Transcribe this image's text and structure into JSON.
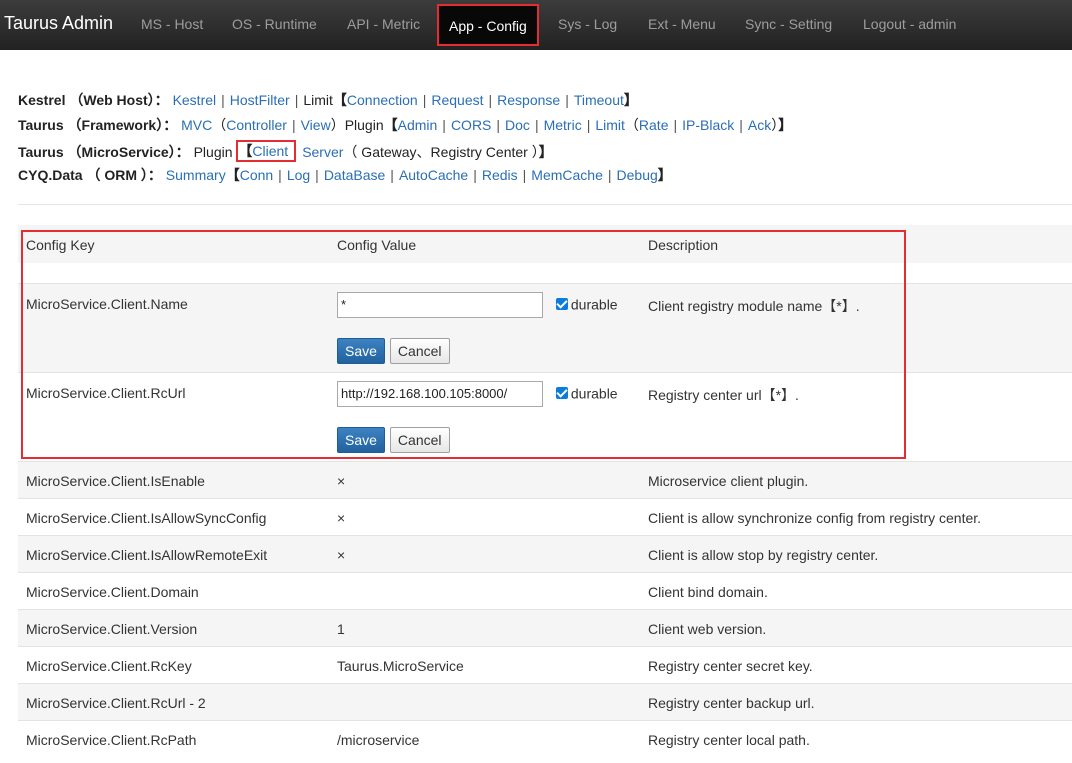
{
  "navbar": {
    "brand": "Taurus Admin",
    "items": [
      {
        "label": "MS - Host"
      },
      {
        "label": "OS - Runtime"
      },
      {
        "label": "API - Metric"
      },
      {
        "label": "App - Config",
        "active": true
      },
      {
        "label": "Sys - Log"
      },
      {
        "label": "Ext - Menu"
      },
      {
        "label": "Sync - Setting"
      },
      {
        "label": "Logout - admin"
      }
    ]
  },
  "menu": {
    "kestrel": {
      "label": "Kestrel （Web Host）：",
      "kestrel": "Kestrel",
      "hostfilter": "HostFilter",
      "limit": "Limit",
      "connection": "Connection",
      "request": "Request",
      "response": "Response",
      "timeout": "Timeout"
    },
    "framework": {
      "label": "Taurus （Framework）：",
      "mvc": "MVC",
      "controller": "Controller",
      "view": "View",
      "plugin": "Plugin",
      "admin": "Admin",
      "cors": "CORS",
      "doc": "Doc",
      "metric": "Metric",
      "limit": "Limit",
      "rate": "Rate",
      "ipblack": "IP-Black",
      "ack": "Ack"
    },
    "microservice": {
      "label": "Taurus （MicroService）：",
      "plugin": "Plugin",
      "client": "Client",
      "server": "Server",
      "server_detail": "（ Gateway、Registry Center ）"
    },
    "orm": {
      "label": "CYQ.Data （ ORM ）：",
      "summary": "Summary",
      "conn": "Conn",
      "log": "Log",
      "database": "DataBase",
      "autocache": "AutoCache",
      "redis": "Redis",
      "memcache": "MemCache",
      "debug": "Debug"
    }
  },
  "table": {
    "headers": {
      "key": "Config Key",
      "value": "Config Value",
      "description": "Description"
    },
    "editable_rows": [
      {
        "key": "MicroService.Client.Name",
        "value": "*",
        "durable_label": "durable",
        "durable": true,
        "description": "Client registry module name【*】.",
        "save": "Save",
        "cancel": "Cancel"
      },
      {
        "key": "MicroService.Client.RcUrl",
        "value": "http://192.168.100.105:8000/",
        "durable_label": "durable",
        "durable": true,
        "description": "Registry center url【*】.",
        "save": "Save",
        "cancel": "Cancel"
      }
    ],
    "rows": [
      {
        "key": "MicroService.Client.IsEnable",
        "value": "×",
        "description": "Microservice client plugin."
      },
      {
        "key": "MicroService.Client.IsAllowSyncConfig",
        "value": "×",
        "description": "Client is allow synchronize config from registry center."
      },
      {
        "key": "MicroService.Client.IsAllowRemoteExit",
        "value": "×",
        "description": "Client is allow stop by registry center."
      },
      {
        "key": "MicroService.Client.Domain",
        "value": "",
        "description": "Client bind domain."
      },
      {
        "key": "MicroService.Client.Version",
        "value": "1",
        "description": "Client web version."
      },
      {
        "key": "MicroService.Client.RcKey",
        "value": "Taurus.MicroService",
        "description": "Registry center secret key."
      },
      {
        "key": "MicroService.Client.RcUrl - 2",
        "value": "",
        "description": "Registry center backup url."
      },
      {
        "key": "MicroService.Client.RcPath",
        "value": "/microservice",
        "description": "Registry center local path."
      }
    ]
  }
}
